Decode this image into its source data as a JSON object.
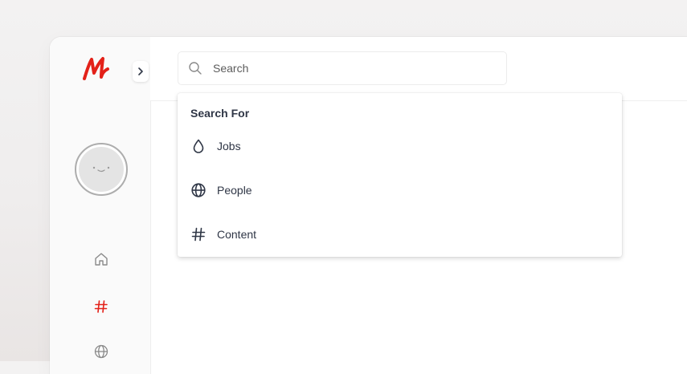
{
  "brand": {
    "logo_text": "M",
    "logo_color": "#e32119"
  },
  "sidebar": {
    "expand_icon": "chevron-right-icon",
    "avatar_icon": "smiley-face-icon",
    "nav": [
      {
        "icon": "home-icon",
        "color": "#8a8a8a"
      },
      {
        "icon": "hashtag-icon",
        "color": "#e32119"
      },
      {
        "icon": "globe-icon",
        "color": "#8a8a8a"
      }
    ]
  },
  "search": {
    "placeholder": "Search",
    "value": ""
  },
  "dropdown": {
    "header": "Search For",
    "items": [
      {
        "label": "Jobs",
        "icon": "drop-icon"
      },
      {
        "label": "People",
        "icon": "globe-icon"
      },
      {
        "label": "Content",
        "icon": "hashtag-icon"
      }
    ]
  },
  "colors": {
    "text_dark": "#2f3646",
    "icon_gray": "#8a8a8a",
    "accent": "#e32119"
  }
}
